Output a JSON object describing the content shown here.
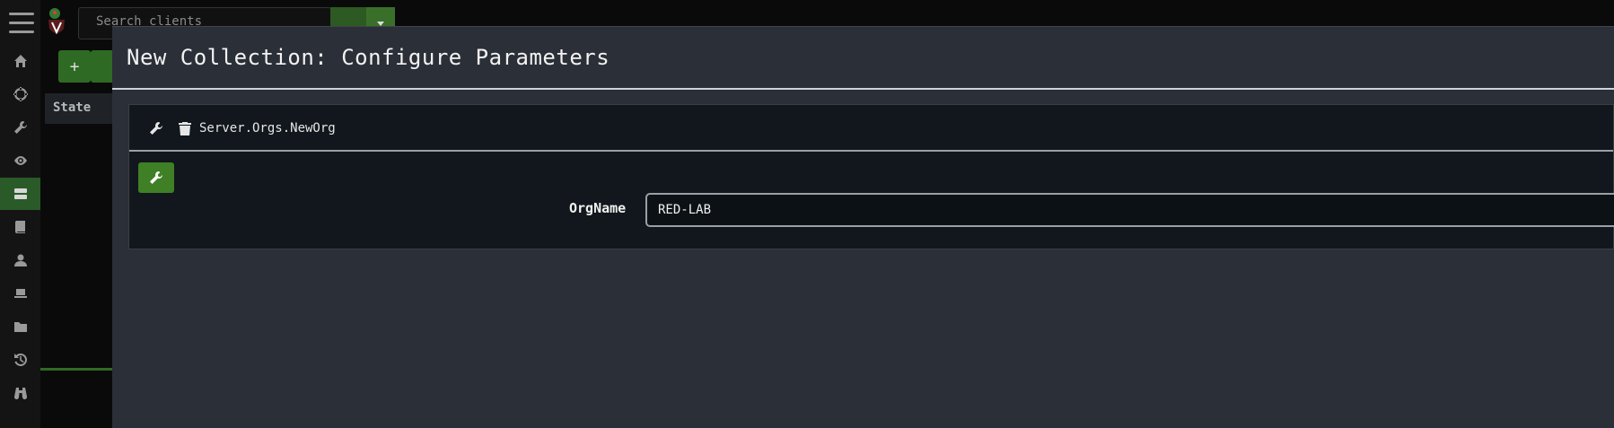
{
  "search": {
    "placeholder": "Search clients"
  },
  "background": {
    "state_column_header": "State"
  },
  "sidebar": {
    "items": [
      {
        "icon": "home-icon"
      },
      {
        "icon": "crosshair-icon"
      },
      {
        "icon": "wrench-icon"
      },
      {
        "icon": "eye-icon"
      },
      {
        "icon": "server-icon",
        "active": true
      },
      {
        "icon": "book-icon"
      },
      {
        "icon": "user-icon"
      },
      {
        "icon": "laptop-icon"
      },
      {
        "icon": "folder-icon"
      },
      {
        "icon": "history-icon"
      },
      {
        "icon": "binoculars-icon"
      }
    ]
  },
  "modal": {
    "title": "New Collection: Configure Parameters",
    "artifact": {
      "name": "Server.Orgs.NewOrg"
    },
    "parameters": [
      {
        "label": "OrgName",
        "value": "RED-LAB"
      }
    ]
  },
  "colors": {
    "accent": "#3f7f25",
    "modal_bg": "#2b2f38",
    "card_bg": "#11171c"
  }
}
